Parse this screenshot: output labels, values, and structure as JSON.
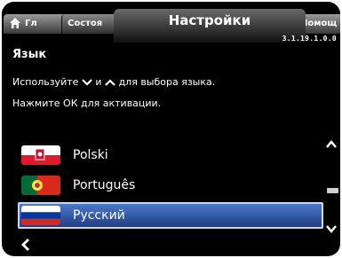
{
  "tabs": {
    "home_label": "Гл",
    "status_label": "Состоя",
    "active_label": "Настройки",
    "help_label": "Помощ"
  },
  "version": "3.1.19.1.0.0",
  "section": {
    "title": "Язык",
    "instruction_part1": "Используйте",
    "instruction_and": "и",
    "instruction_part2": "для выбора языка.",
    "instruction_line2": "Нажмите ОК для активации."
  },
  "languages": [
    {
      "name": "Polski",
      "flag": "polish-flag-icon",
      "selected": false
    },
    {
      "name": "Português",
      "flag": "portuguese-flag-icon",
      "selected": false
    },
    {
      "name": "Русский",
      "flag": "russian-flag-icon",
      "selected": true
    }
  ],
  "colors": {
    "selection": "#2f5aa8",
    "background": "#000000"
  }
}
